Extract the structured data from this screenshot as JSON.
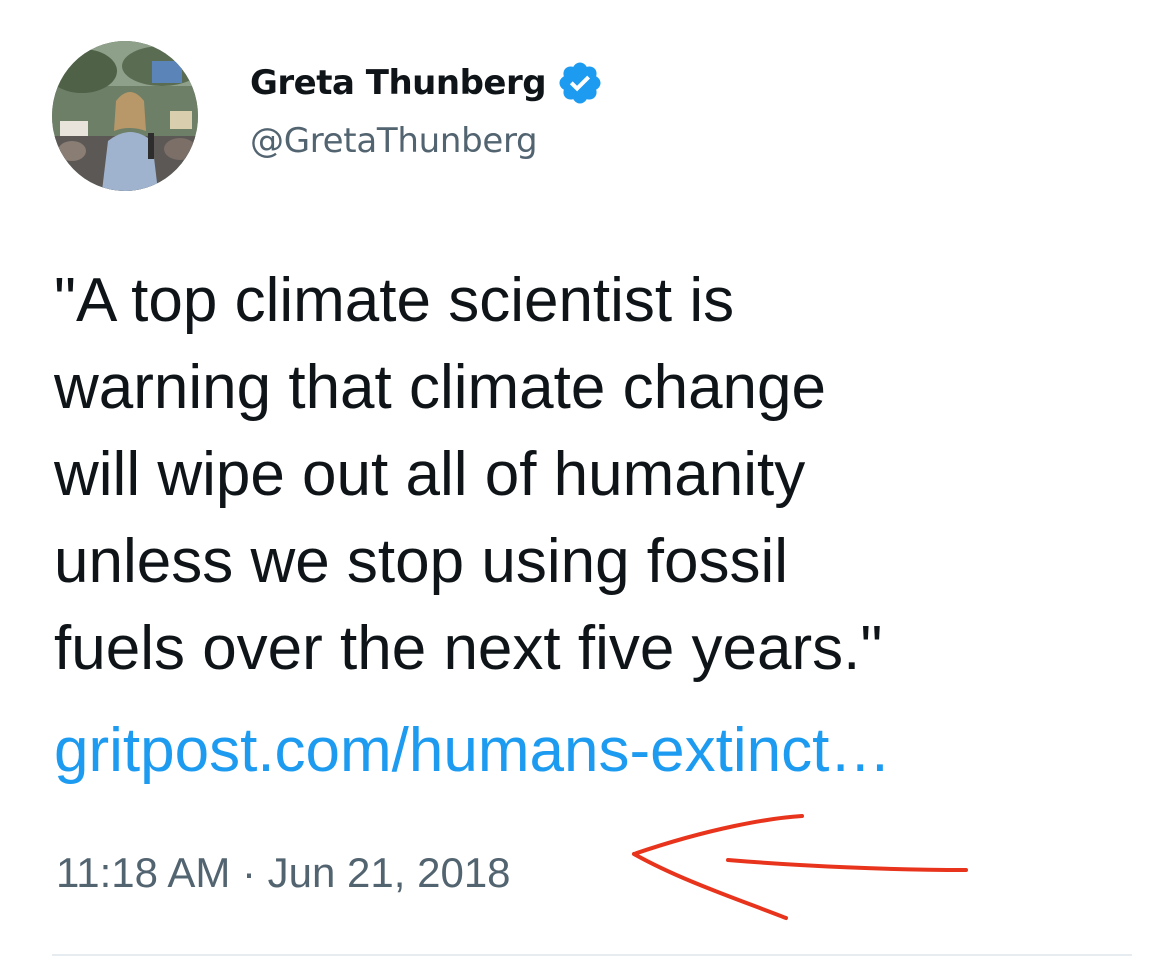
{
  "author": {
    "display_name": "Greta Thunberg",
    "handle": "@GretaThunberg",
    "verified_icon": "verified-badge-icon"
  },
  "tweet": {
    "text_lines": [
      "\"A top climate scientist is",
      "warning that climate change",
      "will wipe out all of humanity",
      "unless we stop using fossil",
      "fuels over the next five years.\""
    ],
    "link": "gritpost.com/humans-extinct…",
    "timestamp": "11:18 AM · Jun 21, 2018"
  },
  "annotation": {
    "type": "hand-drawn-arrow",
    "color": "#e8341c"
  },
  "colors": {
    "text": "#0f1419",
    "secondary": "#536471",
    "link": "#1d9bf0",
    "verified": "#1d9bf0"
  }
}
